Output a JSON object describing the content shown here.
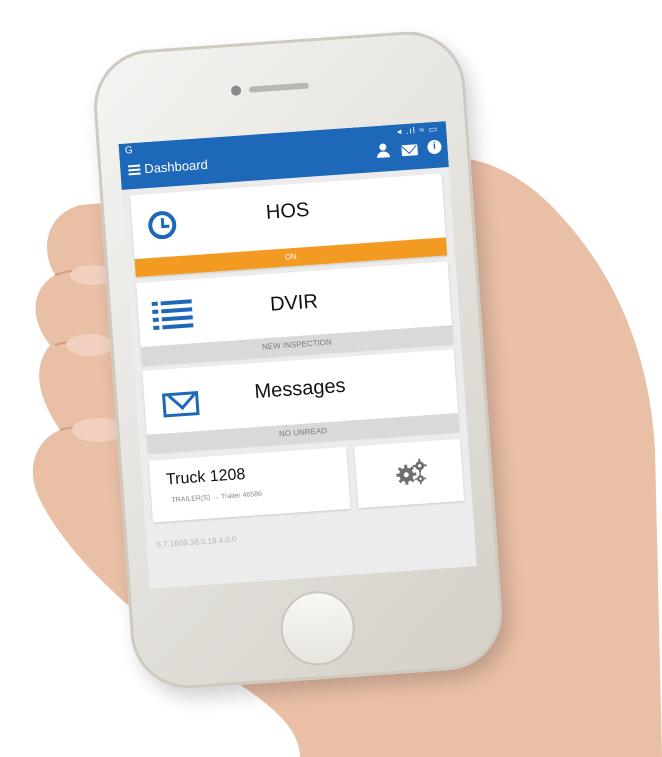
{
  "status_bar": {
    "carrier_glyph": "G",
    "icons": "◂ .ıl ≈ ▭"
  },
  "app_bar": {
    "title": "Dashboard"
  },
  "cards": {
    "hos": {
      "title": "HOS",
      "status": "ON",
      "status_color": "#f29a21"
    },
    "dvir": {
      "title": "DVIR",
      "status": "NEW INSPECTION"
    },
    "messages": {
      "title": "Messages",
      "status": "NO UNREAD"
    }
  },
  "vehicle": {
    "title": "Truck 1208",
    "trailer": "TRAILER(S) → Trailer 46586"
  },
  "footer": {
    "version": "5.7.1609.38.0.19.4.0.0"
  },
  "colors": {
    "primary": "#1d68b8",
    "accent": "#f29a21"
  }
}
